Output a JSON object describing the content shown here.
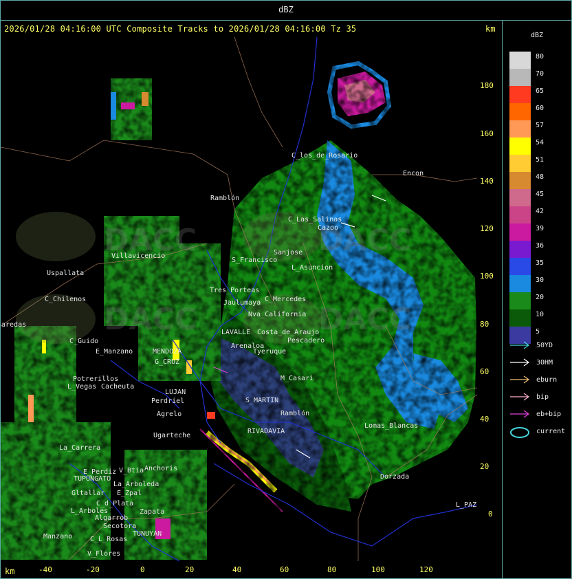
{
  "top_title": "dBZ",
  "header": {
    "text": "2026/01/28 04:16:00 UTC Composite Tracks to 2026/01/28 04:16:00 Tz 35",
    "km_top": "km",
    "km_bottom": "km"
  },
  "axis": {
    "y_ticks": [
      "180",
      "160",
      "140",
      "120",
      "100",
      "80",
      "60",
      "40",
      "20",
      "0"
    ],
    "x_ticks": [
      "-40",
      "-20",
      "0",
      "20",
      "40",
      "60",
      "80",
      "100",
      "120"
    ]
  },
  "legend": {
    "title": "dBZ",
    "scale": [
      {
        "label": "80",
        "color": "#d8d8d8"
      },
      {
        "label": "70",
        "color": "#b8b8b8"
      },
      {
        "label": "65",
        "color": "#ff3a20"
      },
      {
        "label": "60",
        "color": "#ff6600"
      },
      {
        "label": "57",
        "color": "#ff9955"
      },
      {
        "label": "54",
        "color": "#ffff00"
      },
      {
        "label": "51",
        "color": "#ffcc33"
      },
      {
        "label": "48",
        "color": "#d88a30"
      },
      {
        "label": "45",
        "color": "#d06a8c"
      },
      {
        "label": "42",
        "color": "#cc4488"
      },
      {
        "label": "39",
        "color": "#cc1aa0"
      },
      {
        "label": "36",
        "color": "#7a1ad0"
      },
      {
        "label": "35",
        "color": "#2a4ae8"
      },
      {
        "label": "30",
        "color": "#1a8ae0"
      },
      {
        "label": "20",
        "color": "#1a8a1a"
      },
      {
        "label": "10",
        "color": "#0a5a0a"
      },
      {
        "label": "5",
        "color": "#3a3aa0"
      }
    ],
    "tracks": [
      {
        "label": "50YD",
        "color": "#44d8e0"
      },
      {
        "label": "30HM",
        "color": "#ffffff"
      },
      {
        "label": "eburn",
        "color": "#f0c070"
      },
      {
        "label": "bip",
        "color": "#ffb0d0"
      },
      {
        "label": "eb+bip",
        "color": "#e040e0"
      },
      {
        "label": "current",
        "color": "#44d8e0"
      }
    ]
  },
  "places": [
    {
      "name": "Ramblón"
    },
    {
      "name": "Villavicencio"
    },
    {
      "name": "Uspallata"
    },
    {
      "name": "C_Chilenos"
    },
    {
      "name": "aredas"
    },
    {
      "name": "C_Guido"
    },
    {
      "name": "E_Manzano"
    },
    {
      "name": "Potrerillos"
    },
    {
      "name": "L_Vegas"
    },
    {
      "name": "Cacheuta"
    },
    {
      "name": "MENDOZA"
    },
    {
      "name": "G_CRUZ"
    },
    {
      "name": "LUJAN"
    },
    {
      "name": "Perdriel"
    },
    {
      "name": "Agrelo"
    },
    {
      "name": "Ugarteche"
    },
    {
      "name": "La_Carrera"
    },
    {
      "name": "E_Perdiz"
    },
    {
      "name": "TUPUNGATO"
    },
    {
      "name": "V_Btia"
    },
    {
      "name": "Anchoris"
    },
    {
      "name": "Gltallar"
    },
    {
      "name": "E_Zpal"
    },
    {
      "name": "La_Arboleda"
    },
    {
      "name": "L_Arboles"
    },
    {
      "name": "C_d_Plata"
    },
    {
      "name": "Zapata"
    },
    {
      "name": "Algarrob"
    },
    {
      "name": "Secotora"
    },
    {
      "name": "TUNUYAN"
    },
    {
      "name": "C_L_Rosas"
    },
    {
      "name": "Manzano"
    },
    {
      "name": "V_Flores"
    },
    {
      "name": "L_Asuncion"
    },
    {
      "name": "Sanjose"
    },
    {
      "name": "S_Francisco"
    },
    {
      "name": "Tres_Porteas"
    },
    {
      "name": "Jaulumaya"
    },
    {
      "name": "LAVALLE"
    },
    {
      "name": "Costa_de_Araujo"
    },
    {
      "name": "C_Mercedes"
    },
    {
      "name": "Nva_California"
    },
    {
      "name": "Arenaloa"
    },
    {
      "name": "Pescadero"
    },
    {
      "name": "Tyeruque"
    },
    {
      "name": "M_Casari"
    },
    {
      "name": "S_MARTIN"
    },
    {
      "name": "Ramblón"
    },
    {
      "name": "RIVADAVIA"
    },
    {
      "name": "Lomas_Blancas"
    },
    {
      "name": "Dorzada"
    },
    {
      "name": "L_PAZ"
    },
    {
      "name": "Encon"
    },
    {
      "name": "C_Las_Salinas"
    },
    {
      "name": "C_los_de_Rosario"
    },
    {
      "name": "Cazoo"
    }
  ]
}
